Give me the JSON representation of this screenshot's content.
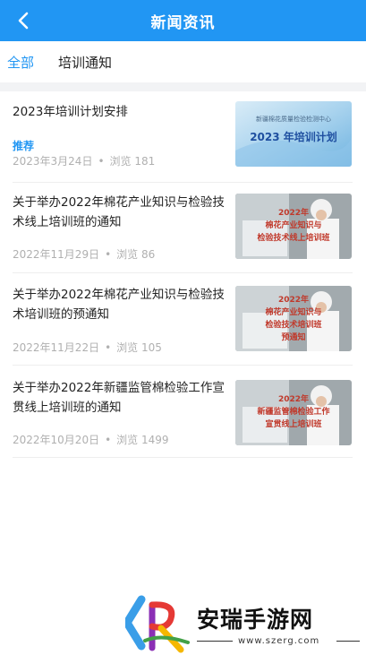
{
  "header": {
    "title": "新闻资讯"
  },
  "tabs": [
    {
      "label": "全部"
    },
    {
      "label": "培训通知"
    }
  ],
  "news": [
    {
      "title": "2023年培训计划安排",
      "tag": "推荐",
      "date": "2023年3月24日",
      "views_label": "浏览 181",
      "image_caption_top": "新疆棉花质量检验检测中心",
      "image_caption": "2023 年培训计划"
    },
    {
      "title": "关于举办2022年棉花产业知识与检验技术线上培训班的通知",
      "date": "2022年11月29日",
      "views_label": "浏览 86",
      "image_lines": [
        "2022年",
        "棉花产业知识与",
        "检验技术线上培训班"
      ]
    },
    {
      "title": "关于举办2022年棉花产业知识与检验技术培训班的预通知",
      "date": "2022年11月22日",
      "views_label": "浏览 105",
      "image_lines": [
        "2022年",
        "棉花产业知识与",
        "检验技术培训班",
        "预通知"
      ]
    },
    {
      "title": "关于举办2022年新疆监管棉检验工作宣贯线上培训班的通知",
      "date": "2022年10月20日",
      "views_label": "浏览 1499",
      "image_lines": [
        "2022年",
        "新疆监管棉检验工作",
        "宣贯线上培训班"
      ]
    }
  ],
  "watermark": {
    "text": "安瑞手游网",
    "url": "www.szerg.com"
  },
  "colors": {
    "primary": "#2196f3",
    "meta": "#b0b0b0",
    "divider": "#f2f3f5"
  }
}
